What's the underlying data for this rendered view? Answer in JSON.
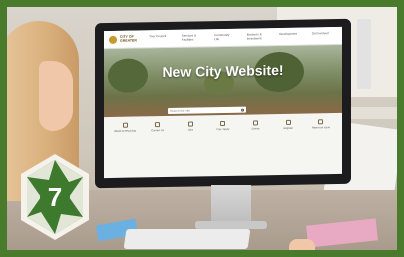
{
  "site": {
    "logo_text": "CITY OF GREATER",
    "nav": [
      "Your Council",
      "Services & Facilities",
      "Community Life",
      "Business & Investment",
      "Development",
      "Get Involved"
    ],
    "hero_title": "New City Website!",
    "search_placeholder": "Search the site",
    "quicklinks": [
      "Waste & Recycling",
      "Contact Us",
      "Jobs",
      "Pay / Apply",
      "Events",
      "Register",
      "Report an issue"
    ]
  },
  "badge": {
    "number": "7"
  },
  "colors": {
    "frame": "#4a7a2c",
    "badge": "#3d7a2e"
  }
}
